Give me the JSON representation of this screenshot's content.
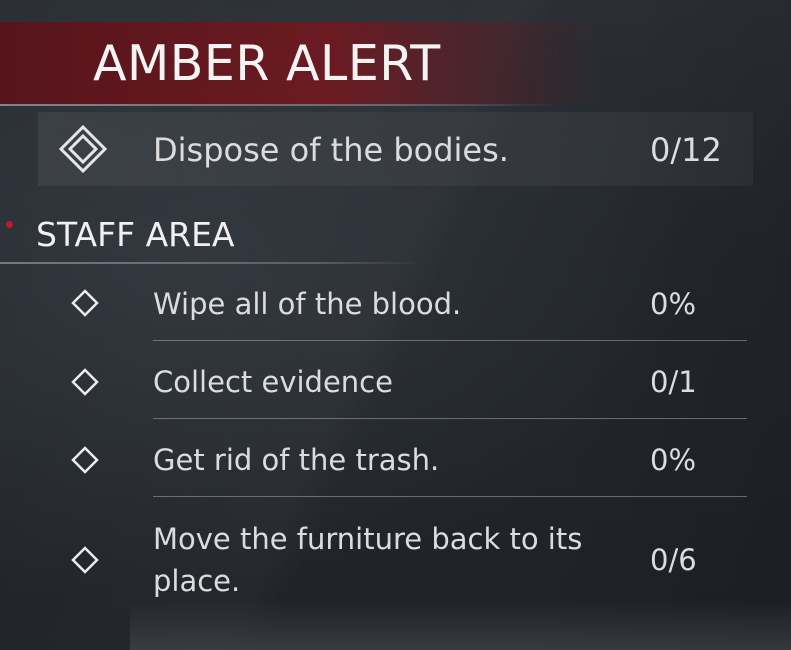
{
  "objectives_panel": {
    "title": "AMBER ALERT",
    "main_objective": {
      "label": "Dispose of the bodies.",
      "progress": "0/12",
      "icon": "double-diamond-icon"
    },
    "section": {
      "title": "STAFF AREA",
      "accent_color": "#c01a2a"
    },
    "tasks": [
      {
        "label": "Wipe all of the blood.",
        "progress": "0%",
        "icon": "diamond-outline-icon"
      },
      {
        "label": "Collect evidence",
        "progress": "0/1",
        "icon": "diamond-outline-icon"
      },
      {
        "label": "Get rid of the trash.",
        "progress": "0%",
        "icon": "diamond-outline-icon"
      },
      {
        "label": "Move the furniture back to its place.",
        "progress": "0/6",
        "icon": "diamond-outline-icon"
      }
    ]
  },
  "colors": {
    "banner": "#76161e",
    "text": "#dcdcde",
    "background": "#23272d"
  }
}
